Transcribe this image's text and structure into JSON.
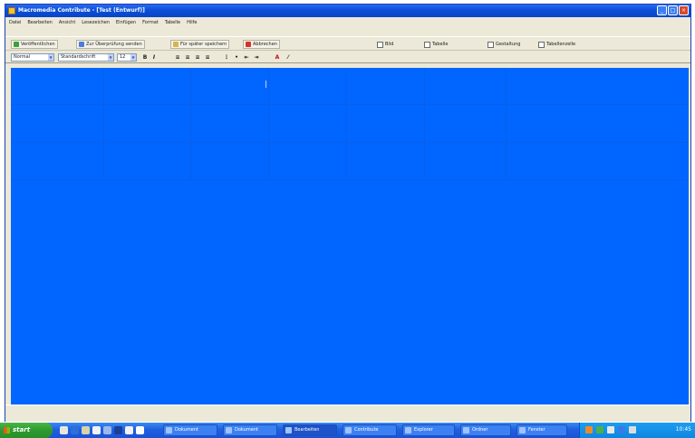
{
  "window": {
    "title": "Macromedia Contribute - [Test (Entwurf)]"
  },
  "menubar": [
    "Datei",
    "Bearbeiten",
    "Ansicht",
    "Lesezeichen",
    "Einfügen",
    "Format",
    "Tabelle",
    "Hilfe"
  ],
  "toolbar1": {
    "publish": "Veröffentlichen",
    "submit": "Zur Überprüfung senden",
    "save": "Für später speichern",
    "cancel": "Abbrechen",
    "image": "Bild",
    "table": "Tabelle",
    "checks": [
      "Gestaltung",
      "Tabellenzelle"
    ]
  },
  "toolbar2": {
    "style": "Normal",
    "font": "Standardschrift",
    "size": "12",
    "format_icons": [
      "B",
      "I"
    ]
  },
  "taskbar": {
    "start_label": "start",
    "tasks": [
      "Dokument",
      "Dokument",
      "Bearbeiten",
      "Contribute",
      "Explorer",
      "Ordner",
      "Fenster"
    ],
    "clock": "10:45"
  },
  "colors": {
    "canvas": "#0066ff",
    "titlebar": "#0a4fd8",
    "start": "#2e9a2e"
  }
}
